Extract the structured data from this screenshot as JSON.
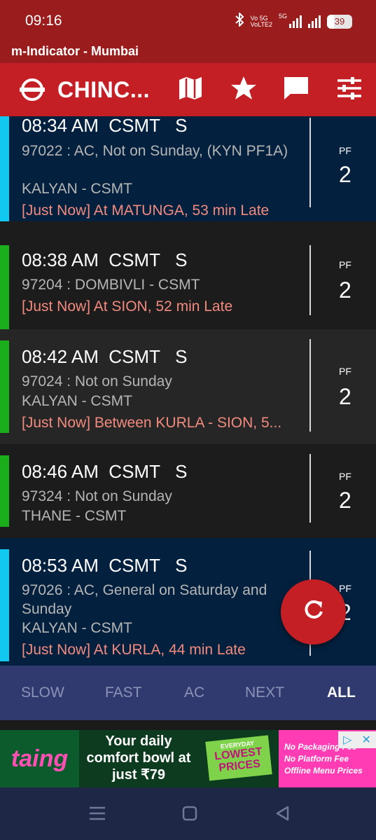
{
  "status": {
    "time": "09:16",
    "volte_top": "Vo 5G",
    "volte_bottom": "VoLTE2",
    "fiveg": "5G",
    "battery": "39"
  },
  "app": {
    "title": "m-Indicator - Mumbai",
    "station": "CHINC..."
  },
  "icons": {
    "logo": "rail-logo-icon",
    "map": "map-icon",
    "favorite": "star-icon",
    "chat": "chat-icon",
    "settings": "sliders-icon",
    "refresh": "refresh-icon"
  },
  "trains": [
    {
      "time": "08:34 AM  CSMT   S",
      "lines": [
        "97022 : AC, Not on Sunday, (KYN PF1A)",
        "KALYAN - CSMT"
      ],
      "live": "[Just Now] At MATUNGA, 53 min Late",
      "pf_label": "PF",
      "pf": "2",
      "color": "#10c8f0"
    },
    {
      "time": "08:38 AM  CSMT   S",
      "lines": [
        "97204 : DOMBIVLI - CSMT"
      ],
      "live": "[Just Now] At SION, 52 min Late",
      "pf_label": "PF",
      "pf": "2",
      "color": "#1aae1a"
    },
    {
      "time": "08:42 AM  CSMT   S",
      "lines": [
        "97024 : Not on Sunday",
        "KALYAN - CSMT"
      ],
      "live": "[Just Now] Between KURLA - SION, 5...",
      "pf_label": "PF",
      "pf": "2",
      "color": "#1aae1a"
    },
    {
      "time": "08:46 AM  CSMT   S",
      "lines": [
        "97324 : Not on Sunday",
        "THANE - CSMT"
      ],
      "live": "",
      "pf_label": "PF",
      "pf": "2",
      "color": "#1aae1a"
    },
    {
      "time": "08:53 AM  CSMT   S",
      "lines": [
        "97026 : AC, General on Saturday and Sunday",
        "KALYAN - CSMT"
      ],
      "live": "[Just Now] At KURLA, 44 min Late",
      "pf_label": "PF",
      "pf": "2",
      "color": "#10c8f0"
    }
  ],
  "tabs": [
    "SLOW",
    "FAST",
    "AC",
    "NEXT",
    "ALL"
  ],
  "active_tab": "ALL",
  "ad": {
    "brand": "taing",
    "tagline": "Your daily comfort bowl at just ₹79",
    "badge_top": "EVERYDAY",
    "badge_main": "LOWEST PRICES",
    "offers": [
      "No Packaging Fee",
      "No Platform Fee",
      "Offline Menu Prices"
    ]
  },
  "colors": {
    "status_bar": "#9a1c1c",
    "toolbar": "#c41f24",
    "ac_card": "#03213f",
    "card_dark": "#1c1c1c",
    "card_alt": "#262626",
    "late_text": "#f28a7e",
    "tabbar": "#303a6e"
  }
}
